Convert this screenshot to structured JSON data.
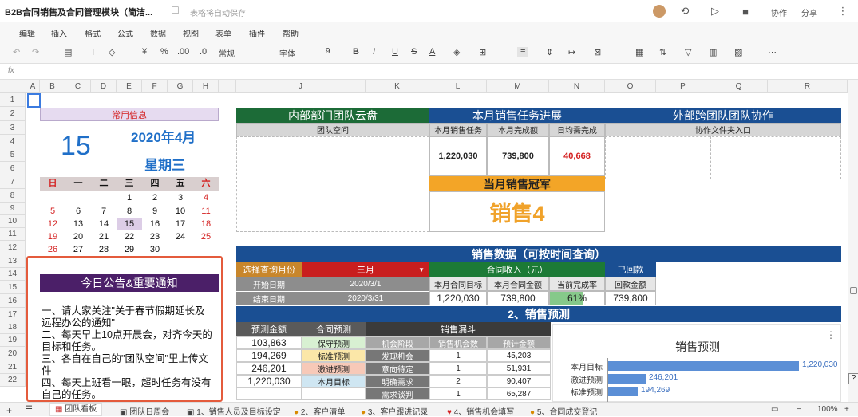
{
  "window": {
    "doc_title": "B2B合同销售及合同管理模块（简洁...",
    "autosave": "表格将自动保存",
    "collab": "协作",
    "share": "分享"
  },
  "menu": [
    "编辑",
    "插入",
    "格式",
    "公式",
    "数据",
    "视图",
    "表单",
    "插件",
    "帮助"
  ],
  "toolbar": {
    "currency": "¥",
    "percent": "%",
    "dec_add": ".00",
    "dec_sub": ".0",
    "format": "常规",
    "font": "字体",
    "size": "9",
    "bold": "B",
    "italic": "I",
    "underline": "U",
    "strike": "S",
    "color": "A"
  },
  "formula_bar": {
    "fx": "fx"
  },
  "columns": [
    "A",
    "B",
    "C",
    "D",
    "E",
    "F",
    "G",
    "H",
    "I",
    "J",
    "K",
    "L",
    "M",
    "N",
    "O",
    "P",
    "Q",
    "R",
    "S"
  ],
  "rows": [
    "1",
    "2",
    "3",
    "4",
    "5",
    "6",
    "7",
    "8",
    "9",
    "10",
    "11",
    "12",
    "13",
    "14",
    "15",
    "16",
    "17",
    "18",
    "19",
    "20",
    "21",
    "22"
  ],
  "info": {
    "header": "常用信息",
    "day": "15",
    "year_month": "2020年4月",
    "weekday": "星期三",
    "week_headers": [
      "日",
      "一",
      "二",
      "三",
      "四",
      "五",
      "六"
    ],
    "weeks": [
      [
        "",
        "",
        "",
        "1",
        "2",
        "3",
        "4"
      ],
      [
        "5",
        "6",
        "7",
        "8",
        "9",
        "10",
        "11"
      ],
      [
        "12",
        "13",
        "14",
        "15",
        "16",
        "17",
        "18"
      ],
      [
        "19",
        "20",
        "21",
        "22",
        "23",
        "24",
        "25"
      ],
      [
        "26",
        "27",
        "28",
        "29",
        "30",
        "",
        ""
      ]
    ]
  },
  "notice": {
    "title": "今日公告&重要通知",
    "lines": [
      "一、请大家关注\"关于春节假期延长及",
      "远程办公的通知\"",
      "二、每天早上10点开晨会，对齐今天的",
      "目标和任务。",
      "三、各自在自己的\"团队空间\"里上传文",
      "件",
      "四、每天上班看一眼，超时任务有没有",
      "自己的任务。"
    ]
  },
  "team_space": {
    "header": "内部部门团队云盘",
    "sub": "团队空间"
  },
  "sales_task": {
    "header": "本月销售任务进展",
    "cols": [
      "本月销售任务",
      "本月完成额",
      "日均需完成"
    ],
    "values": [
      "1,220,030",
      "739,800",
      "40,668"
    ],
    "champion_title": "当月销售冠军",
    "champion": "销售4"
  },
  "collab": {
    "header": "外部跨团队团队协作",
    "sub": "协作文件夹入口"
  },
  "sales_data": {
    "header": "销售数据（可按时间查询）",
    "select_label": "选择查询月份",
    "selected_month": "三月",
    "income_label": "合同收入（元）",
    "returned_label": "已回款",
    "start_label": "开始日期",
    "start_value": "2020/3/1",
    "end_label": "结束日期",
    "end_value": "2020/3/31",
    "col_target": "本月合同目标",
    "col_amount": "本月合同金额",
    "col_rate": "当前完成率",
    "col_return": "回款金额",
    "target": "1,220,030",
    "amount": "739,800",
    "rate": "61%",
    "return_amount": "739,800"
  },
  "forecast": {
    "header": "2、销售预测",
    "col1": "预测金额",
    "col2": "合同预测",
    "funnel": "销售漏斗",
    "funnel_cols": [
      "机会阶段",
      "销售机会数",
      "预计金额"
    ],
    "rows": [
      {
        "amount": "103,863",
        "type": "保守预测",
        "stage": "",
        "count": "",
        "est": ""
      },
      {
        "amount": "194,269",
        "type": "标准预测",
        "stage": "发现机会",
        "count": "1",
        "est": "45,203"
      },
      {
        "amount": "246,201",
        "type": "激进预测",
        "stage": "意向待定",
        "count": "1",
        "est": "51,931"
      },
      {
        "amount": "1,220,030",
        "type": "本月目标",
        "stage": "明确需求",
        "count": "2",
        "est": "90,407"
      },
      {
        "amount": "",
        "type": "",
        "stage": "需求谈判",
        "count": "1",
        "est": "65,287"
      }
    ]
  },
  "chart_data": {
    "type": "bar",
    "title": "销售预测",
    "categories": [
      "本月目标",
      "激进预测",
      "标准预测"
    ],
    "values": [
      1220030,
      246201,
      194269
    ],
    "labels": [
      "1,220,030",
      "246,201",
      "194,269"
    ],
    "color": "#5b8fd6"
  },
  "sheet_tabs": [
    "团队看板",
    "团队日周会",
    "1、销售人员及目标设定",
    "2、客户清单",
    "3、客户跟进记录",
    "4、销售机会填写",
    "5、合同成交登记"
  ],
  "zoom": "100%"
}
